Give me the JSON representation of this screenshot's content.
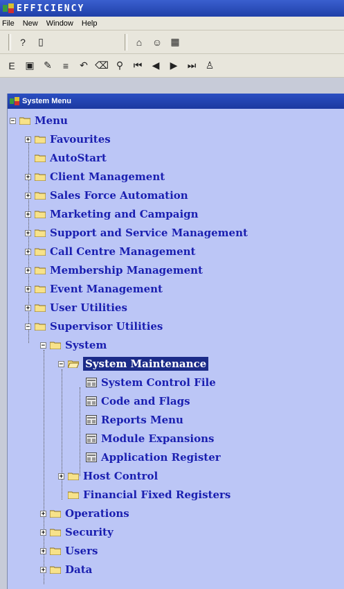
{
  "app": {
    "title": "EFFICIENCY"
  },
  "menubar": {
    "items": [
      "File",
      "New",
      "Window",
      "Help"
    ]
  },
  "toolbar": {
    "row1": [
      "help-icon",
      "exit-icon",
      "bank-icon",
      "people-icon",
      "grid-icon"
    ],
    "row2": [
      "font-icon",
      "save-icon",
      "clear-icon",
      "align-icon",
      "undo-icon",
      "eraser-icon",
      "binoculars-icon",
      "first-record-icon",
      "prev-record-icon",
      "next-record-icon",
      "last-record-icon",
      "user-icon"
    ]
  },
  "panel": {
    "title": "System Menu"
  },
  "tree": {
    "root": "Menu",
    "items": [
      {
        "label": "Favourites"
      },
      {
        "label": "AutoStart"
      },
      {
        "label": "Client Management"
      },
      {
        "label": "Sales Force Automation"
      },
      {
        "label": "Marketing and Campaign"
      },
      {
        "label": "Support and Service Management"
      },
      {
        "label": "Call Centre Management"
      },
      {
        "label": "Membership Management"
      },
      {
        "label": "Event Management"
      },
      {
        "label": "User Utilities"
      },
      {
        "label": "Supervisor Utilities"
      },
      {
        "label": "System"
      },
      {
        "label": "System Maintenance"
      },
      {
        "label": "System Control File"
      },
      {
        "label": "Code and Flags"
      },
      {
        "label": "Reports Menu"
      },
      {
        "label": "Module Expansions"
      },
      {
        "label": "Application Register"
      },
      {
        "label": "Host Control"
      },
      {
        "label": "Financial Fixed Registers"
      },
      {
        "label": "Operations"
      },
      {
        "label": "Security"
      },
      {
        "label": "Users"
      },
      {
        "label": "Data"
      }
    ]
  },
  "colors": {
    "panel_bg": "#bcc6f6",
    "label": "#1a1fb0",
    "selected_bg": "#1b2b88",
    "titlebar": "#1f3fa8"
  }
}
